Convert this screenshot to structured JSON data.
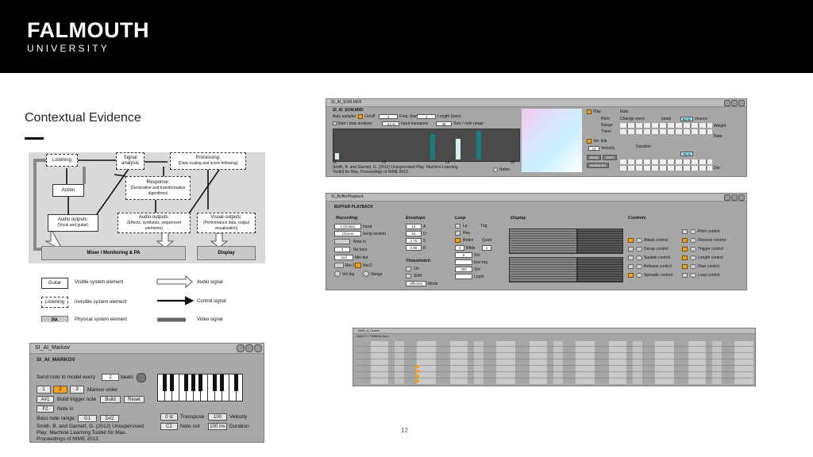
{
  "header": {
    "brand": "FALMOUTH",
    "sub": "UNIVERSITY"
  },
  "slide": {
    "title": "Contextual Evidence",
    "page_number": "12"
  },
  "diagram": {
    "boxes": {
      "listening": "Listening",
      "signal_analysis": "Signal analysis",
      "processing": "Processing:",
      "processing_sub": "(Data scaling and score following)",
      "action": "Action",
      "response": "Response:",
      "response_sub": "(Generative and transformative algorithms)",
      "audio_out_left": "Audio outputs:",
      "audio_out_left_sub": "(Vocal and guitar)",
      "audio_out_mid": "Audio outputs:",
      "audio_out_mid_sub": "(Effects, synthesis, sequenced elements)",
      "visual_out": "Visual outputs:",
      "visual_out_sub": "(Performance data, output visualisation)",
      "mixer": "Mixer / Monitoring & PA",
      "display": "Display"
    },
    "legend": {
      "guitar": "Guitar",
      "visible": "Visible system element",
      "listening": "Listening",
      "invisible": "Invisible system element",
      "pa": "PA",
      "physical": "Physical system element",
      "audio_signal": "Audio signal",
      "control_signal": "Control signal",
      "video_signal": "Video signal"
    }
  },
  "som_panel": {
    "title": "SI_AI_SOM.MIDI",
    "subtitle": "SI_AI_SOM.MIDI",
    "auto_sampler": "Auto sampler",
    "on_off": "On/off",
    "freq_val": "4",
    "freq": "Freq. (bars)",
    "length_val": "1",
    "length": "Length (bars)",
    "start_stop": "Start / stop analysis",
    "transpose_val": "-24 st",
    "input_transpose": "Input transpose",
    "size_val": "36",
    "size": "Size / note range",
    "ticks": [
      "c2",
      "c3",
      "c4",
      "b5"
    ],
    "credit": "Smith, B. and Garnett, G. (2012) Unsupervised Play: Machine Learning Toolkit for Max, Proceedings of NIME 2012.",
    "notes": "Notes",
    "play": "Play",
    "rate": "Rate",
    "pitch": "Pitch",
    "range": "Range",
    "trans": "Trans",
    "change_every": "Change every",
    "beats": "beats",
    "pct": "80 %",
    "chance": "chance",
    "weight": "Weight",
    "vel_link": "Vel. link",
    "velocity": "Velocity",
    "vel_val": "74",
    "duration": "Duration",
    "dump": "dump",
    "reset": "reset",
    "randomize": "randomize",
    "pct2": "75 %",
    "rate2": "Rate",
    "dur": "Dur"
  },
  "buffer_panel": {
    "title": "SI_BufferPlayback",
    "heading": "BUFFER PLAYBACK",
    "recording": "Recording",
    "input_val": "1 (Guitar)",
    "input": "Input",
    "song_val": "Chorus",
    "song_section": "Song section",
    "note_in": "Note in",
    "no_bars_val": "3",
    "no_bars": "No bars",
    "min_dur_val": "2nd",
    "min_dur": "Min dur",
    "rec1": "Rec1",
    "rec2": "Rec2",
    "vel_trig": "Vel trig",
    "strngs": "Strngs",
    "envelope": "Envelope",
    "env_vals": [
      "14",
      "61",
      "2 76",
      "2 88"
    ],
    "env_lbls": [
      "A",
      "D",
      "S",
      "R"
    ],
    "timestretch": "Timestretch",
    "on": "On",
    "shift": "Shift",
    "efficient": "efficient",
    "mode": "Mode",
    "loop": "Loop",
    "lp": "Lp",
    "rev": "Rev",
    "rndm": "Rndm",
    "trig": "Trig",
    "quick": "Quick",
    "rflds": "Rflds",
    "rflds_val": "4",
    "quick_val": "2",
    "start_val": "6",
    "start": "Strt",
    "env_trig": "Env trig",
    "start_ms": "300",
    "lngth": "Lngth",
    "display": "Display",
    "controls": "Controls",
    "ctrl_left": [
      "Attack control",
      "Decay control",
      "Sustain control",
      "Release control",
      "Sporadic control"
    ],
    "ctrl_right": [
      "Pitch control",
      "Reverse control",
      "Trigger control",
      "Length control",
      "Start control",
      "Loop control"
    ]
  },
  "control_panel": {
    "title": "NoiSi_AI_Control",
    "subtitle": "NoiSi FX / TIMBRAL Bus 1",
    "rows": [
      "Intro",
      "Verse",
      "Chorus",
      "Bridge",
      "Outro"
    ],
    "cols": [
      "Pitch",
      "Pitch",
      "Pitch",
      "Pitch",
      "Pitch"
    ]
  },
  "markov_panel": {
    "title": "SI_AI_Markov",
    "heading": "SI_AI_MARKOV",
    "send_note": "Send note to model every",
    "send_val": "2",
    "beats": "beats",
    "orders": [
      "1",
      "2",
      "3"
    ],
    "markov_order": "Markov order",
    "trigger_val": "A#1",
    "build_trigger": "Build trigger note",
    "build": "Build",
    "reset": "Reset",
    "note_in_val": "F2",
    "note_in": "Note in",
    "bass_range": "Bass note range:",
    "range_lo": "G1",
    "range_hi": "D#2",
    "transpose_val": "0 st",
    "transpose": "Transpose",
    "velocity_val": "100",
    "velocity": "Velocity",
    "note_out_val": "C2",
    "note_out": "Note out",
    "duration_val": "100 ms",
    "duration": "Duration",
    "credit": "Smith, B. and Garnett, G. (2012) Unsupervised Play: Machine Learning Toolkit for Max. Proceedings of NIME 2012."
  }
}
